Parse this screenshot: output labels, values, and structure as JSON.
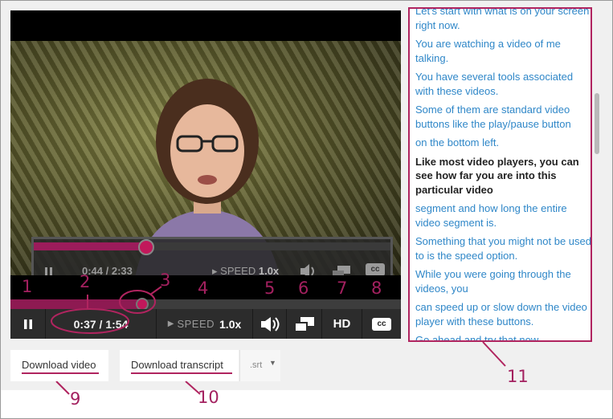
{
  "player": {
    "time": "0:37 / 1:54",
    "speed_label": "SPEED",
    "speed_value": "1.0x",
    "hd_label": "HD",
    "cc_label": "cc",
    "progress": 0.33
  },
  "inset": {
    "time": "0:44 / 2:33",
    "speed_label": "SPEED",
    "speed_value": "1.0x",
    "cc_label": "cc"
  },
  "callouts": {
    "n1": "1",
    "n2": "2",
    "n3": "3",
    "n4": "4",
    "n5": "5",
    "n6": "6",
    "n7": "7",
    "n8": "8",
    "n9": "9",
    "n10": "10",
    "n11": "11"
  },
  "transcript": {
    "lines": [
      "Let's start with what is on your screen right now.",
      "You are watching a video of me talking.",
      "You have several tools associated with these videos.",
      "Some of them are standard video buttons like the play/pause button",
      "on the bottom left.",
      "Like most video players, you can see how far you are into this particular video",
      "segment and how long the entire video segment is.",
      "Something that you might not be used to is the speed option.",
      "While you were going through the videos, you",
      "can speed up or slow down the video player with these buttons.",
      "Go ahead and try that now."
    ],
    "active_index": 5
  },
  "downloads": {
    "video_label": "Download video",
    "transcript_label": "Download transcript",
    "format_label": ".srt"
  },
  "colors": {
    "accent": "#b0245f",
    "link": "#2f87c8",
    "bar": "#2c2c2c"
  }
}
